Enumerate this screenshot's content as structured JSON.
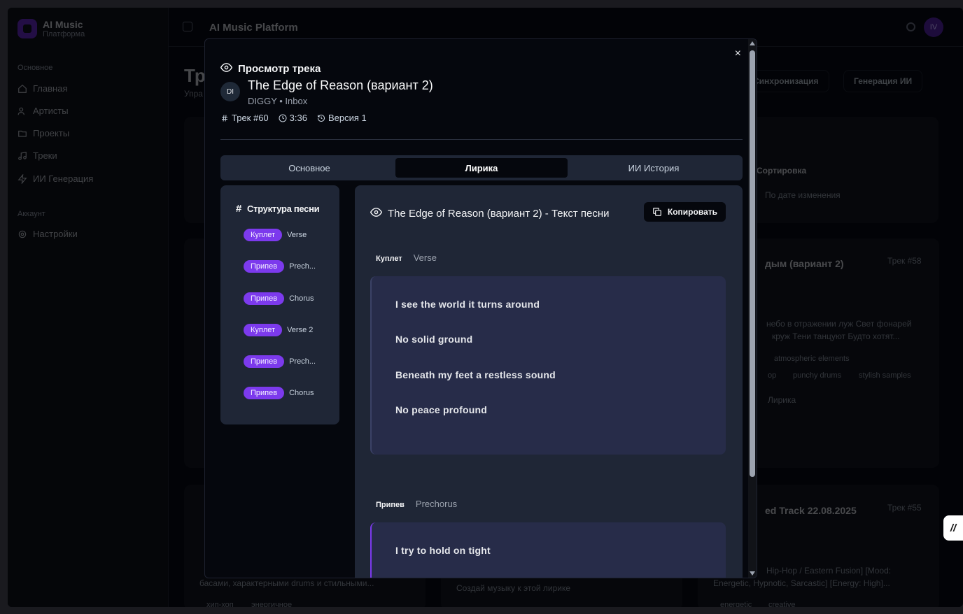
{
  "app": {
    "brand_title": "AI Music",
    "brand_sub": "Платформа",
    "topbar_title": "AI Music Platform",
    "user_initials": "IV"
  },
  "sidebar": {
    "section_main": "Основное",
    "items": [
      {
        "label": "Главная",
        "icon": "home-icon"
      },
      {
        "label": "Артисты",
        "icon": "users-icon"
      },
      {
        "label": "Проекты",
        "icon": "folder-icon"
      },
      {
        "label": "Треки",
        "icon": "music-icon"
      },
      {
        "label": "ИИ Генерация",
        "icon": "zap-icon"
      }
    ],
    "section_account": "Аккаунт",
    "settings_label": "Настройки"
  },
  "background": {
    "page_title": "Тр",
    "page_sub": "Упра",
    "sync_button": "Синхронизация",
    "ai_gen_button": "Генерация ИИ",
    "sort_label": "Сортировка",
    "sort_value": "По дате изменения",
    "card1_title": "дым (вариант 2)",
    "card1_num": "Трек #58",
    "card1_text1": "небо в отражении луж Свет фонарей",
    "card1_text2": "круж Тени танцуют Будто хотят...",
    "tag1": "atmospheric elements",
    "tag2": "op",
    "tag3": "punchy drums",
    "tag4": "stylish samples",
    "lyrics_label": "Лирика",
    "card2_title": "ed Track 22.08.2025",
    "card2_num": "Трек #55",
    "card2_text1": "Hip-Hop / Eastern Fusion] [Mood:",
    "card2_text2": "Energetic, Hypnotic, Sarcastic] [Energy: High]...",
    "bottom_text1": "басами, характерными drums и стильными...",
    "bottom_text2": "Создай музыку к этой лирике",
    "bottom_tag1": "хип-хоп",
    "bottom_tag2": "энергичное",
    "bottom_tag3": "energetic",
    "bottom_tag4": "creative"
  },
  "modal": {
    "header": "Просмотр трека",
    "close": "×",
    "avatar": "DI",
    "title": "The Edge of Reason (вариант 2)",
    "subtitle": "DIGGY • Inbox",
    "meta_track": "Трек #60",
    "meta_duration": "3:36",
    "meta_version": "Версия 1",
    "tabs": [
      "Основное",
      "Лирика",
      "ИИ История"
    ],
    "active_tab": "Лирика"
  },
  "structure": {
    "title": "Структура песни",
    "items": [
      {
        "badge": "Куплет",
        "label": "Verse"
      },
      {
        "badge": "Припев",
        "label": "Prech..."
      },
      {
        "badge": "Припев",
        "label": "Chorus"
      },
      {
        "badge": "Куплет",
        "label": "Verse 2"
      },
      {
        "badge": "Припев",
        "label": "Prech..."
      },
      {
        "badge": "Припев",
        "label": "Chorus"
      }
    ]
  },
  "lyrics": {
    "heading": "The Edge of Reason (вариант 2) - Текст песни",
    "copy_label": "Копировать",
    "sections": [
      {
        "kind": "Куплет",
        "name": "Verse",
        "lines": [
          "I see the world it turns around",
          "No solid ground",
          "Beneath my feet a restless sound",
          "No peace profound"
        ]
      },
      {
        "kind": "Припев",
        "name": "Prechorus",
        "lines": [
          "I try to hold on tight"
        ]
      }
    ]
  },
  "colors": {
    "accent": "#7c3aed",
    "panel": "#1f2636",
    "verse_box": "#272c49"
  }
}
